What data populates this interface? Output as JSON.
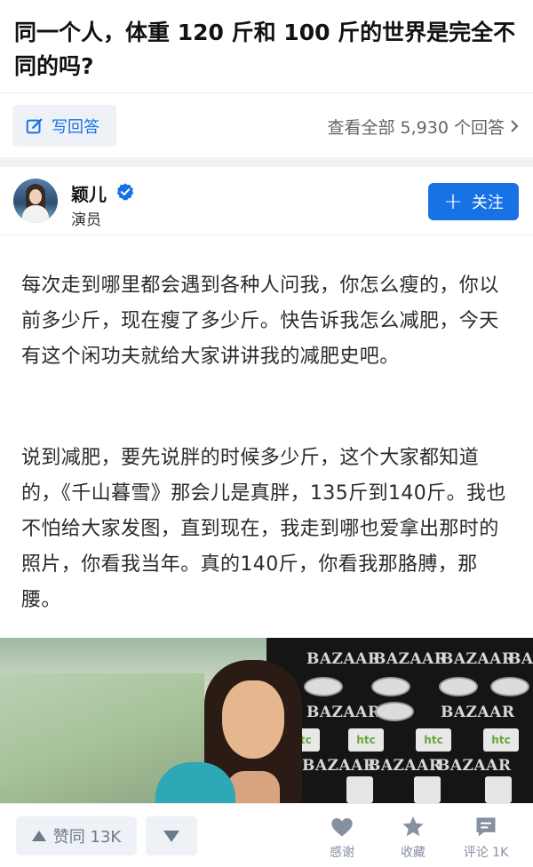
{
  "question": {
    "title": "同一个人，体重 120 斤和 100 斤的世界是完全不同的吗?"
  },
  "toolbar": {
    "write_answer_label": "写回答",
    "view_all_label": "查看全部 5,930 个回答"
  },
  "author": {
    "name": "颖儿",
    "title": "演员",
    "follow_label": "关注",
    "verified_color": "#1772e6"
  },
  "answer": {
    "paragraphs": [
      "每次走到哪里都会遇到各种人问我，你怎么瘦的，你以前多少斤，现在瘦了多少斤。快告诉我怎么减肥，今天有这个闲功夫就给大家讲讲我的减肥史吧。",
      "说到减肥，要先说胖的时候多少斤，这个大家都知道的，《千山暮雪》那会儿是真胖，135斤到140斤。我也不怕给大家发图，直到现在，我走到哪也爱拿出那时的照片，你看我当年。真的140斤，你看我那胳膊，那腰。"
    ],
    "photo_logos": {
      "brand": "BAZAAR",
      "sponsor": "htc"
    }
  },
  "bottom_bar": {
    "upvote_label": "赞同 13K",
    "thanks_label": "感谢",
    "favorite_label": "收藏",
    "comment_label": "评论 1K"
  },
  "colors": {
    "accent": "#1772e6",
    "icon_gray": "#8590a0"
  }
}
